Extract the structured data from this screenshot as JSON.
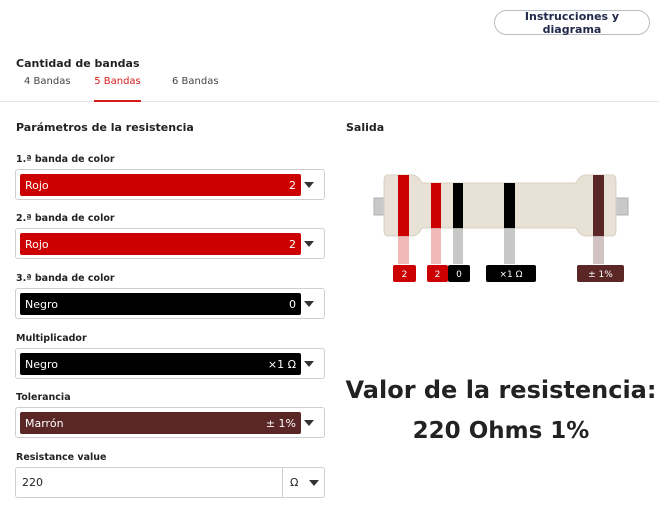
{
  "header": {
    "instructions_button": "Instrucciones y diagrama"
  },
  "bands_section": {
    "title": "Cantidad de bandas",
    "tabs": [
      {
        "label": "4 Bandas",
        "active": false
      },
      {
        "label": "5 Bandas",
        "active": true
      },
      {
        "label": "6 Bandas",
        "active": false
      }
    ]
  },
  "params": {
    "title": "Parámetros de la resistencia",
    "fields": [
      {
        "label": "1.ª banda de color",
        "color_name": "Rojo",
        "value": "2",
        "color": "#cc0000",
        "caret_icon": "chevron-down-icon"
      },
      {
        "label": "2.ª banda de color",
        "color_name": "Rojo",
        "value": "2",
        "color": "#cc0000",
        "caret_icon": "chevron-down-icon"
      },
      {
        "label": "3.ª banda de color",
        "color_name": "Negro",
        "value": "0",
        "color": "#000000",
        "caret_icon": "chevron-down-icon"
      },
      {
        "label": "Multiplicador",
        "color_name": "Negro",
        "value": "×1 Ω",
        "color": "#000000",
        "caret_icon": "chevron-down-icon"
      },
      {
        "label": "Tolerancia",
        "color_name": "Marrón",
        "value": "± 1%",
        "color": "#5a2626",
        "caret_icon": "chevron-down-icon"
      }
    ],
    "resistance": {
      "label": "Resistance value",
      "value": "220",
      "unit": "Ω",
      "caret_icon": "chevron-down-icon"
    }
  },
  "output": {
    "title": "Salida",
    "resistor_bands": [
      {
        "label": "2",
        "color": "#cc0000"
      },
      {
        "label": "2",
        "color": "#cc0000"
      },
      {
        "label": "0",
        "color": "#000000"
      },
      {
        "label": "×1 Ω",
        "color": "#000000"
      },
      {
        "label": "± 1%",
        "color": "#5a2626"
      }
    ],
    "result_heading": "Valor de la resistencia:",
    "result_value": "220 Ohms 1%"
  },
  "colors": {
    "accent": "#d41c1c",
    "resistor_body": "#e8e1d6",
    "lead": "#c9c9c9"
  }
}
